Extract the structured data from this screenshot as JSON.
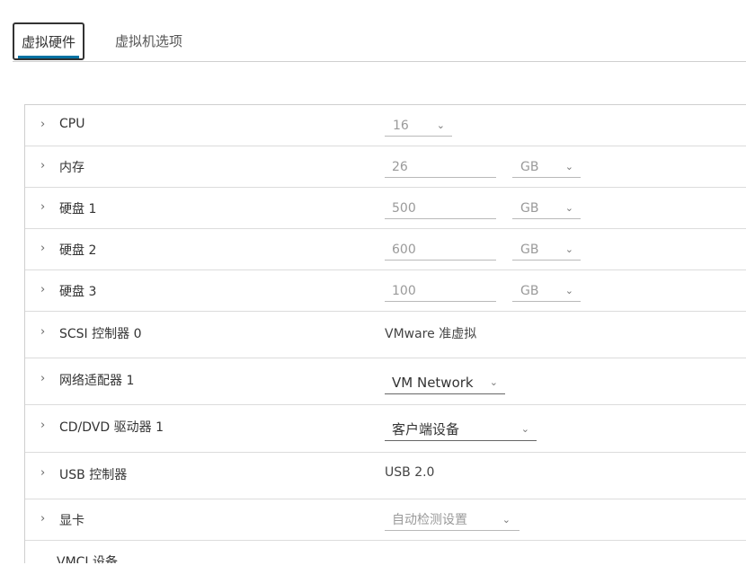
{
  "tabs": [
    {
      "label": "虚拟硬件",
      "active": true
    },
    {
      "label": "虚拟机选项",
      "active": false
    }
  ],
  "rows": {
    "cpu": {
      "label": "CPU",
      "value": "16"
    },
    "memory": {
      "label": "内存",
      "value": "26",
      "unit": "GB"
    },
    "disk1": {
      "label": "硬盘 1",
      "value": "500",
      "unit": "GB"
    },
    "disk2": {
      "label": "硬盘 2",
      "value": "600",
      "unit": "GB"
    },
    "disk3": {
      "label": "硬盘 3",
      "value": "100",
      "unit": "GB"
    },
    "scsi": {
      "label": "SCSI 控制器 0",
      "value": "VMware 准虚拟"
    },
    "network": {
      "label": "网络适配器 1",
      "value": "VM Network"
    },
    "cddvd": {
      "label": "CD/DVD 驱动器 1",
      "value": "客户端设备"
    },
    "usb": {
      "label": "USB 控制器",
      "value": "USB 2.0"
    },
    "video": {
      "label": "显卡",
      "value": "自动检测设置"
    },
    "vmci": {
      "label": "VMCI 设备"
    }
  },
  "icons": {
    "expand": "chevron-right-icon",
    "dropdown": "chevron-down-icon"
  },
  "colors": {
    "tab_accent": "#0072a3",
    "disabled_text": "#9a9a9a"
  }
}
